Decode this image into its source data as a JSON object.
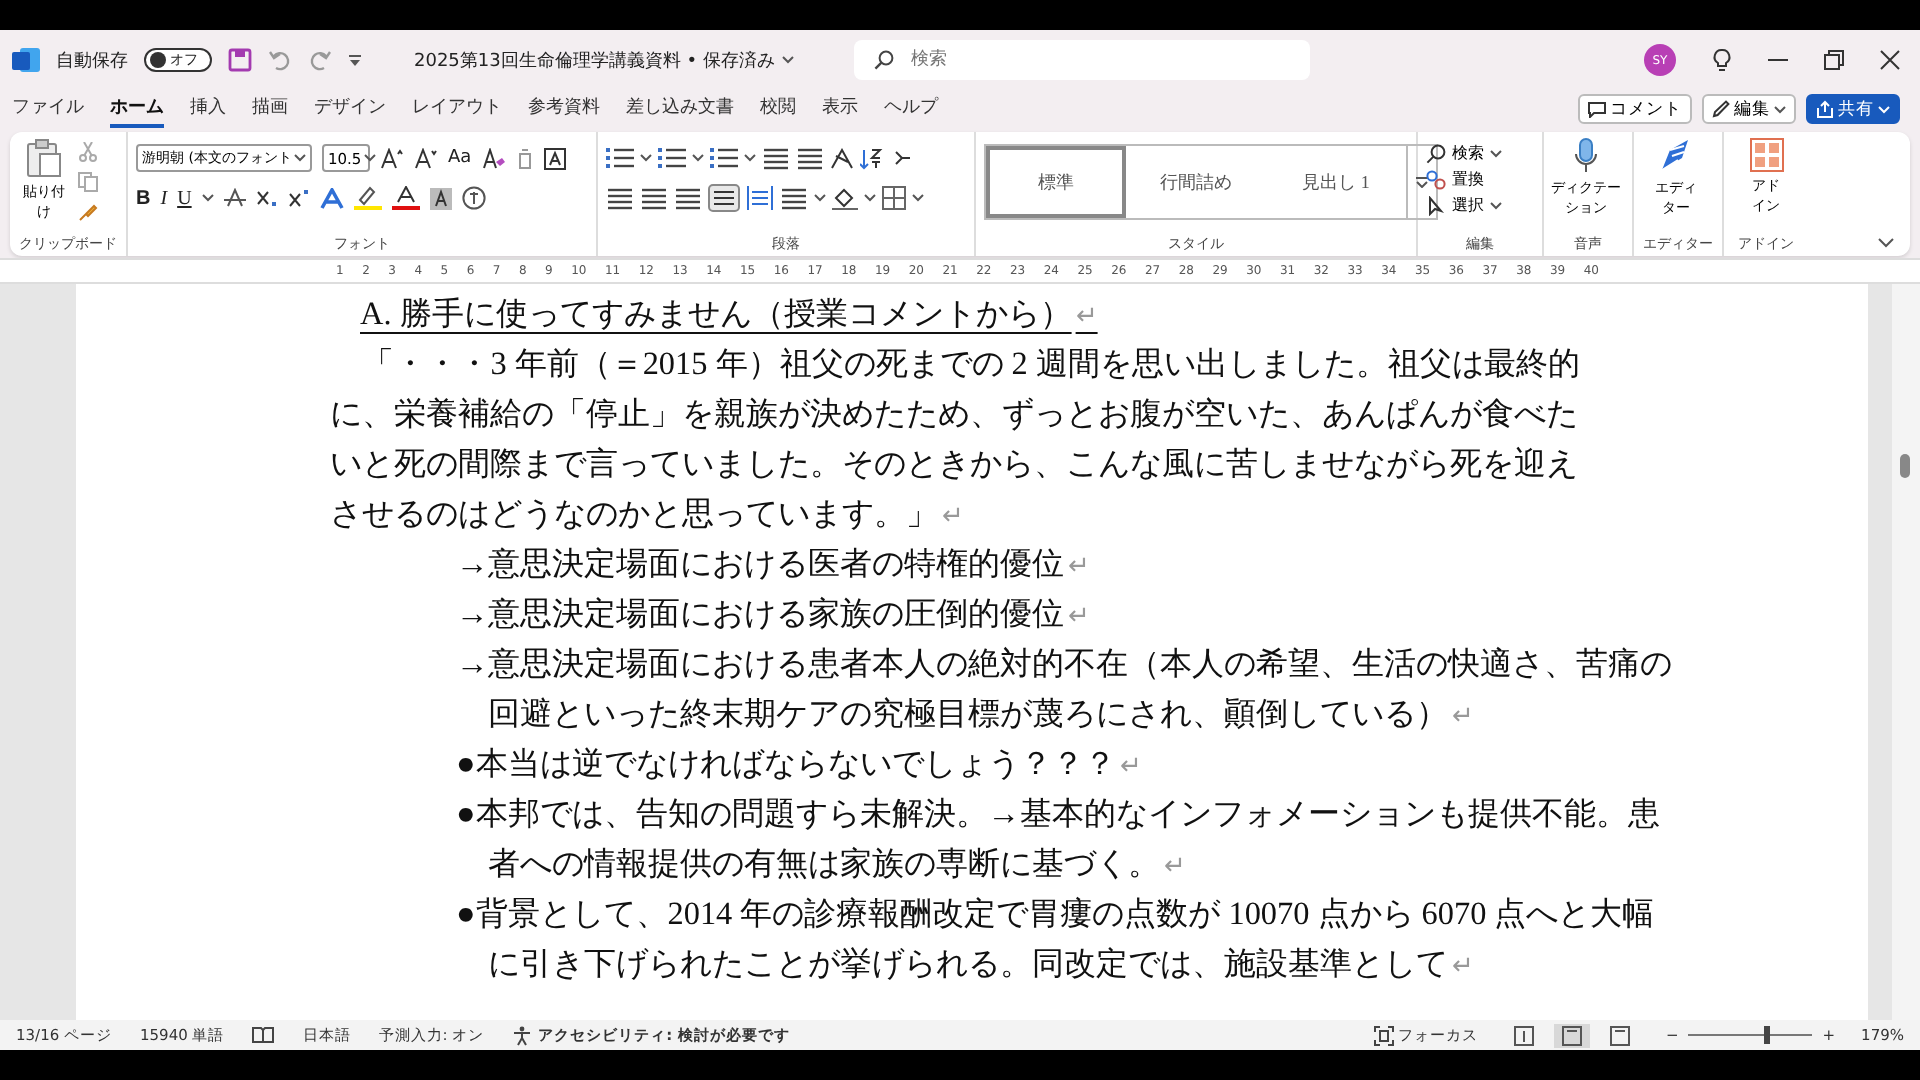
{
  "title_bar": {
    "autosave_label": "自動保存",
    "autosave": {
      "on": false,
      "label": "オフ"
    },
    "document_title": "2025第13回生命倫理学講義資料 • 保存済み",
    "search": {
      "placeholder": "検索"
    },
    "avatar": "SY"
  },
  "tabs": [
    {
      "label": "ファイル",
      "selected": false
    },
    {
      "label": "ホーム",
      "selected": true
    },
    {
      "label": "挿入",
      "selected": false
    },
    {
      "label": "描画",
      "selected": false
    },
    {
      "label": "デザイン",
      "selected": false
    },
    {
      "label": "レイアウト",
      "selected": false
    },
    {
      "label": "参考資料",
      "selected": false
    },
    {
      "label": "差し込み文書",
      "selected": false
    },
    {
      "label": "校閲",
      "selected": false
    },
    {
      "label": "表示",
      "selected": false
    },
    {
      "label": "ヘルプ",
      "selected": false
    }
  ],
  "header_buttons": {
    "comment": "コメント",
    "editing": "編集",
    "share": "共有"
  },
  "ribbon": {
    "clipboard": {
      "paste": "貼り付け",
      "group": "クリップボード"
    },
    "font": {
      "name": "游明朝 (本文のフォント",
      "size": "10.5",
      "change_case": "Aa",
      "bold": "B",
      "italic": "I",
      "underline": "U",
      "group": "フォント"
    },
    "paragraph": {
      "group": "段落"
    },
    "styles": {
      "items": [
        {
          "label": "標準",
          "selected": true
        },
        {
          "label": "行間詰め",
          "selected": false
        },
        {
          "label": "見出し 1",
          "selected": false
        }
      ],
      "group": "スタイル"
    },
    "editing": {
      "find": "検索",
      "replace": "置換",
      "select": "選択",
      "group": "編集"
    },
    "voice": {
      "button": "ディクテーション",
      "group": "音声"
    },
    "editor": {
      "button": "エディター",
      "group": "エディター"
    },
    "addins": {
      "button": "アドイン",
      "group": "アドイン"
    }
  },
  "ruler": {
    "numbers": [
      "1",
      "2",
      "3",
      "4",
      "5",
      "6",
      "7",
      "8",
      "9",
      "10",
      "11",
      "12",
      "13",
      "14",
      "15",
      "16",
      "17",
      "18",
      "19",
      "20",
      "21",
      "22",
      "23",
      "24",
      "25",
      "26",
      "27",
      "28",
      "29",
      "30",
      "31",
      "32",
      "33",
      "34",
      "35",
      "36",
      "37",
      "38",
      "39",
      "40"
    ]
  },
  "document": {
    "paragraphs": [
      {
        "kind": "heading",
        "text": "A.  勝手に使ってすみません（授業コメントから）",
        "mark": "↵"
      },
      {
        "kind": "body",
        "text": "「・・・3 年前（＝2015 年）祖父の死までの 2 週間を思い出しました。祖父は最終的に、栄養補給の「停止」を親族が決めたため、ずっとお腹が空いた、あんぱんが食べたいと死の間際まで言っていました。そのときから、こんな風に苦しませながら死を迎えさせるのはどうなのかと思っています。」",
        "mark": "↵"
      },
      {
        "kind": "item",
        "text": "→意思決定場面における医者の特権的優位",
        "mark": "↵"
      },
      {
        "kind": "item",
        "text": "→意思決定場面における家族の圧倒的優位",
        "mark": "↵"
      },
      {
        "kind": "item",
        "text": "→意思決定場面における患者本人の絶対的不在（本人の希望、生活の快適さ、苦痛の回避といった終末期ケアの究極目標が蔑ろにされ、顚倒している）",
        "mark": "↵"
      },
      {
        "kind": "item",
        "text": "●本当は逆でなければならないでしょう？？？",
        "mark": "↵"
      },
      {
        "kind": "item",
        "text": "●本邦では、告知の問題すら未解決。→基本的なインフォメーションも提供不能。患者への情報提供の有無は家族の専断に基づく。",
        "mark": "↵"
      },
      {
        "kind": "item",
        "text": "●背景として、2014 年の診療報酬改定で胃瘻の点数が 10070 点から 6070 点へと大幅に引き下げられたことが挙げられる。同改定では、施設基準として",
        "mark": "↵"
      }
    ]
  },
  "status_bar": {
    "page": "13/16 ページ",
    "words": "15940 単語",
    "language": "日本語",
    "prediction": "予測入力: オン",
    "accessibility": "アクセシビリティ: 検討が必要です",
    "focus": "フォーカス",
    "views": [
      {
        "selected": false
      },
      {
        "selected": true
      },
      {
        "selected": false
      }
    ],
    "zoom_out": "−",
    "zoom_in": "+",
    "zoom": {
      "level": 0.62
    },
    "zoom_value": "179%"
  }
}
